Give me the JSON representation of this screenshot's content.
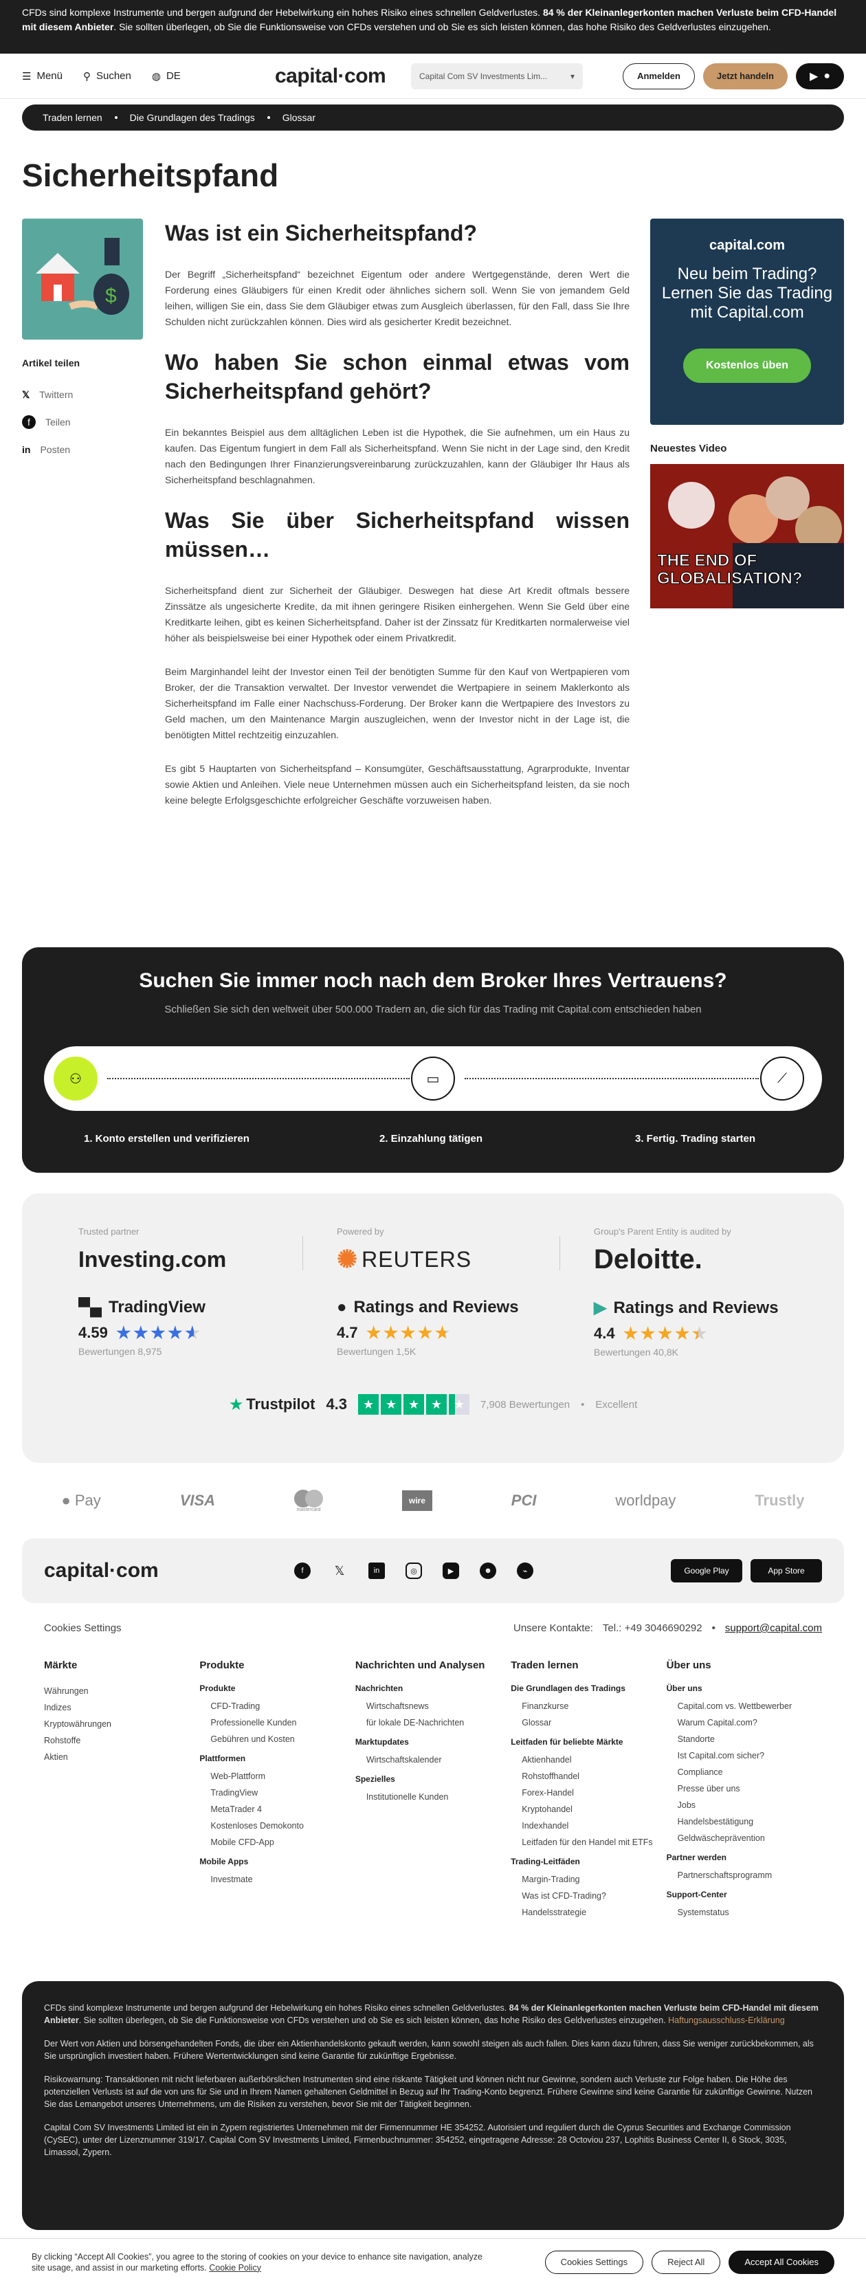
{
  "risk_banner": {
    "text": "CFDs sind komplexe Instrumente und bergen aufgrund der Hebelwirkung ein hohes Risiko eines schnellen Geldverlustes. ",
    "bold": "84 % der Kleinanlegerkonten machen Verluste beim CFD-Handel mit diesem Anbieter",
    "rest": ". Sie sollten überlegen, ob Sie die Funktionsweise von CFDs verstehen und ob Sie es sich leisten können, das hohe Risiko des Geldverlustes einzugehen."
  },
  "header": {
    "menu": "Menü",
    "search": "Suchen",
    "lang": "DE",
    "logo": "capital·com",
    "entity": "Capital Com SV Investments Lim...",
    "login": "Anmelden",
    "trade": "Jetzt handeln"
  },
  "breadcrumb": [
    "Traden lernen",
    "Die Grundlagen des Tradings",
    "Glossar"
  ],
  "page_title": "Sicherheitspfand",
  "share": {
    "heading": "Artikel teilen",
    "items": [
      "Twittern",
      "Teilen",
      "Posten"
    ]
  },
  "article": {
    "h1": "Was ist ein Sicherheitspfand?",
    "p1": "Der Begriff „Sicherheitspfand“ bezeichnet Eigentum oder andere Wertgegenstände, deren Wert die Forderung eines Gläubigers für einen Kredit oder ähnliches sichern soll. Wenn Sie von jemandem Geld leihen, willigen Sie ein, dass Sie dem Gläubiger etwas zum Ausgleich überlassen, für den Fall, dass Sie Ihre Schulden nicht zurückzahlen können. Dies wird als gesicherter Kredit bezeichnet.",
    "h2": "Wo haben Sie schon einmal etwas vom Sicherheitspfand gehört?",
    "p2": "Ein bekanntes Beispiel aus dem alltäglichen Leben ist die Hypothek, die Sie aufnehmen, um ein Haus zu kaufen. Das Eigentum fungiert in dem Fall als Sicherheitspfand. Wenn Sie nicht in der Lage sind, den Kredit nach den Bedingungen Ihrer Finanzierungsvereinbarung zurückzuzahlen, kann der Gläubiger Ihr Haus als Sicherheitspfand beschlagnahmen.",
    "h3": "Was Sie über Sicherheitspfand wissen müssen…",
    "p3": "Sicherheitspfand dient zur Sicherheit der Gläubiger. Deswegen hat diese Art Kredit oftmals bessere Zinssätze als ungesicherte Kredite, da mit ihnen geringere Risiken einhergehen. Wenn Sie Geld über eine Kreditkarte leihen, gibt es keinen Sicherheitspfand. Daher ist der Zinssatz für Kreditkarten normalerweise viel höher als beispielsweise bei einer Hypothek oder einem Privatkredit.",
    "p4": "Beim Marginhandel leiht der Investor einen Teil der benötigten Summe für den Kauf von Wertpapieren vom Broker, der die Transaktion verwaltet. Der Investor verwendet die Wertpapiere in seinem Maklerkonto als Sicherheitspfand im Falle einer Nachschuss-Forderung. Der Broker kann die Wertpapiere des Investors zu Geld machen, um den Maintenance Margin auszugleichen, wenn der Investor nicht in der Lage ist, die benötigten Mittel rechtzeitig einzuzahlen.",
    "p5": "Es gibt 5 Hauptarten von Sicherheitspfand – Konsumgüter, Geschäftsausstattung, Agrarprodukte, Inventar sowie Aktien und Anleihen. Viele neue Unternehmen müssen auch ein Sicherheitspfand leisten, da sie noch keine belegte Erfolgsgeschichte erfolgreicher Geschäfte vorzuweisen haben."
  },
  "promo": {
    "logo": "capital.com",
    "text": "Neu beim Trading? Lernen Sie das Trading mit Capital.com",
    "cta": "Kostenlos üben"
  },
  "video": {
    "heading": "Neuestes Video",
    "caption": "THE END OF GLOBALISATION?"
  },
  "broker": {
    "title": "Suchen Sie immer noch nach dem Broker Ihres Vertrauens?",
    "subtitle": "Schließen Sie sich den weltweit über 500.000 Tradern an, die sich für das Trading mit Capital.com entschieden haben",
    "steps": [
      "1. Konto erstellen und verifizieren",
      "2. Einzahlung tätigen",
      "3. Fertig. Trading starten"
    ]
  },
  "trust": {
    "partners": [
      {
        "label": "Trusted partner",
        "name": "Investing.com"
      },
      {
        "label": "Powered by",
        "name": "REUTERS"
      },
      {
        "label": "Group's Parent Entity is audited by",
        "name": "Deloitte."
      }
    ],
    "ratings": [
      {
        "name": "TradingView",
        "score": "4.59",
        "stars": 4.59,
        "count": "Bewertungen 8,975"
      },
      {
        "name": "Ratings and Reviews",
        "score": "4.7",
        "stars": 4.7,
        "count": "Bewertungen 1,5K"
      },
      {
        "name": "Ratings and Reviews",
        "score": "4.4",
        "stars": 4.4,
        "count": "Bewertungen 40,8K"
      }
    ],
    "trustpilot": {
      "name": "Trustpilot",
      "score": "4.3",
      "stars": 4.3,
      "reviews": "7,908 Bewertungen",
      "label": "Excellent"
    }
  },
  "payments": [
    "Pay",
    "VISA",
    "mastercard",
    "wire",
    "PCI",
    "worldpay",
    "Trustly"
  ],
  "footer": {
    "logo": "capital·com",
    "apps": [
      "Google Play",
      "App Store"
    ],
    "cookie_settings": "Cookies Settings",
    "contact_label": "Unsere Kontakte:",
    "phone": "Tel.: +49 3046690292",
    "email": "support@capital.com",
    "columns": [
      {
        "title": "Märkte",
        "groups": [
          {
            "head": "",
            "items": [
              "Währungen",
              "Indizes",
              "Kryptowährungen",
              "Rohstoffe",
              "Aktien"
            ]
          }
        ]
      },
      {
        "title": "Produkte",
        "groups": [
          {
            "head": "Produkte",
            "items": [
              "CFD-Trading",
              "Professionelle Kunden",
              "Gebühren und Kosten"
            ]
          },
          {
            "head": "Plattformen",
            "items": [
              "Web-Plattform",
              "TradingView",
              "MetaTrader 4",
              "Kostenloses Demokonto",
              "Mobile CFD-App"
            ]
          },
          {
            "head": "Mobile Apps",
            "items": [
              "Investmate"
            ]
          }
        ]
      },
      {
        "title": "Nachrichten und Analysen",
        "groups": [
          {
            "head": "Nachrichten",
            "items": [
              "Wirtschaftsnews",
              "für lokale DE-Nachrichten"
            ]
          },
          {
            "head": "Marktupdates",
            "items": [
              "Wirtschaftskalender"
            ]
          },
          {
            "head": "Spezielles",
            "items": [
              "Institutionelle Kunden"
            ]
          }
        ]
      },
      {
        "title": "Traden lernen",
        "groups": [
          {
            "head": "Die Grundlagen des Tradings",
            "items": [
              "Finanzkurse",
              "Glossar"
            ]
          },
          {
            "head": "Leitfaden für beliebte Märkte",
            "items": [
              "Aktienhandel",
              "Rohstoffhandel",
              "Forex-Handel",
              "Kryptohandel",
              "Indexhandel",
              "Leitfaden für den Handel mit ETFs"
            ]
          },
          {
            "head": "Trading-Leitfäden",
            "items": [
              "Margin-Trading",
              "Was ist CFD-Trading?",
              "Handelsstrategie"
            ]
          }
        ]
      },
      {
        "title": "Über uns",
        "groups": [
          {
            "head": "Über uns",
            "items": [
              "Capital.com vs. Wettbewerber",
              "Warum Capital.com?",
              "Standorte",
              "Ist Capital.com sicher?",
              "Compliance",
              "Presse über uns",
              "Jobs",
              "Handelsbestätigung",
              "Geldwäscheprävention"
            ]
          },
          {
            "head": "Partner werden",
            "items": [
              "Partnerschaftsprogramm"
            ]
          },
          {
            "head": "Support-Center",
            "items": [
              "Systemstatus"
            ]
          }
        ]
      }
    ]
  },
  "legal": {
    "p1a": "CFDs sind komplexe Instrumente und bergen aufgrund der Hebelwirkung ein hohes Risiko eines schnellen Geldverlustes. ",
    "p1b": "84 % der Kleinanlegerkonten machen Verluste beim CFD-Handel mit diesem Anbieter",
    "p1c": ". Sie sollten überlegen, ob Sie die Funktionsweise von CFDs verstehen und ob Sie es sich leisten können, das hohe Risiko des Geldverlustes einzugehen. ",
    "p1link": "Haftungsausschluss-Erklärung",
    "p2": "Der Wert von Aktien und börsengehandelten Fonds, die über ein Aktienhandelskonto gekauft werden, kann sowohl steigen als auch fallen. Dies kann dazu führen, dass Sie weniger zurückbekommen, als Sie ursprünglich investiert haben. Frühere Wertentwicklungen sind keine Garantie für zukünftige Ergebnisse.",
    "p3": "Risikowarnung: Transaktionen mit nicht lieferbaren außerbörslichen Instrumenten sind eine riskante Tätigkeit und können nicht nur Gewinne, sondern auch Verluste zur Folge haben. Die Höhe des potenziellen Verlusts ist auf die von uns für Sie und in Ihrem Namen gehaltenen Geldmittel in Bezug auf Ihr Trading-Konto begrenzt. Frühere Gewinne sind keine Garantie für zukünftige Gewinne. Nutzen Sie das Lemangebot unseres Unternehmens, um die Risiken zu verstehen, bevor Sie mit der Tätigkeit beginnen.",
    "p4": "Capital Com SV Investments Limited ist ein in Zypern registriertes Unternehmen mit der Firmennummer HE 354252. Autorisiert und reguliert durch die Cyprus Securities and Exchange Commission (CySEC), unter der Lizenznummer 319/17. Capital Com SV Investments Limited, Firmenbuchnummer: 354252, eingetragene Adresse: 28 Octoviou 237, Lophitis Business Center II, 6 Stock, 3035, Limassol, Zypern."
  },
  "cookie": {
    "text": "By clicking “Accept All Cookies”, you agree to the storing of cookies on your device to enhance site navigation, analyze site usage, and assist in our marketing efforts. ",
    "link": "Cookie Policy",
    "settings": "Cookies Settings",
    "reject": "Reject All",
    "accept": "Accept All Cookies"
  },
  "colors": {
    "dark": "#1e1e1e",
    "accent_green": "#5fba46",
    "tan": "#c9996a",
    "promo_bg": "#1d3a52",
    "star_orange": "#f5a623",
    "star_blue": "#3a6fe0",
    "trustpilot": "#00b67a"
  }
}
